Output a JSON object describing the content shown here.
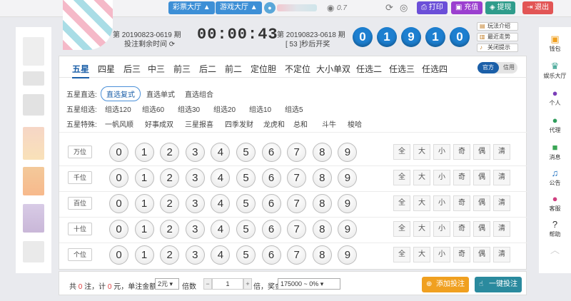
{
  "topbar": {
    "lottery_hall": "彩票大厅",
    "game_hall": "游戏大厅",
    "balance": "0.7",
    "print": "打印",
    "recharge": "充值",
    "withdraw": "提现",
    "logout": "退出"
  },
  "header": {
    "current_issue": "第 20190823-0619 期",
    "bet_remaining": "投注剩余时间",
    "countdown": "00:00:43",
    "last_issue": "第 20190823-0618 期",
    "draw_info": "[ 53 ]秒后开奖",
    "result_numbers": [
      "0",
      "1",
      "9",
      "1",
      "0"
    ],
    "links": {
      "rules": "玩法介绍",
      "trend": "最近走势",
      "close_tip": "关闭提示"
    }
  },
  "tabs": [
    "五星",
    "四星",
    "后三",
    "中三",
    "前三",
    "后二",
    "前二",
    "定位胆",
    "不定位",
    "大小单双",
    "任选二",
    "任选三",
    "任选四"
  ],
  "mode": {
    "official": "官方",
    "credit": "信用"
  },
  "play_groups": [
    {
      "label": "五星直选:",
      "options": [
        "直选复式",
        "直选单式",
        "直选组合"
      ]
    },
    {
      "label": "五星组选:",
      "options": [
        "组选120",
        "组选60",
        "组选30",
        "组选20",
        "组选10",
        "组选5"
      ]
    },
    {
      "label": "五星特殊:",
      "options": [
        "一帆风顺",
        "好事成双",
        "三星报喜",
        "四季发财",
        "龙虎和",
        "总和",
        "斗牛",
        "梭哈"
      ]
    }
  ],
  "positions": [
    "万位",
    "千位",
    "百位",
    "十位",
    "个位"
  ],
  "digits": [
    "0",
    "1",
    "2",
    "3",
    "4",
    "5",
    "6",
    "7",
    "8",
    "9"
  ],
  "quick_select": [
    "全",
    "大",
    "小",
    "奇",
    "偶",
    "清"
  ],
  "bottom": {
    "summary_a": "共",
    "bet_count": "0",
    "summary_b": "注，计",
    "amount": "0",
    "summary_c": "元，单注金额",
    "unit": "2元",
    "multiple_label": "倍数",
    "multiple": "1",
    "multiple_suffix": "倍，奖金",
    "prize": "175000 ~ 0%",
    "add_bet": "添加投注",
    "one_click_bet": "一键投注"
  },
  "right_sidebar": [
    "钱包",
    "娱乐大厅",
    "个人",
    "代理",
    "消息",
    "公告",
    "客服",
    "帮助"
  ],
  "colors": {
    "result_ball": "#1d7fd0",
    "active_tab": "#1b5fa8",
    "add_bet": "#f0a020",
    "one_click_bet": "#2a8a9e"
  }
}
